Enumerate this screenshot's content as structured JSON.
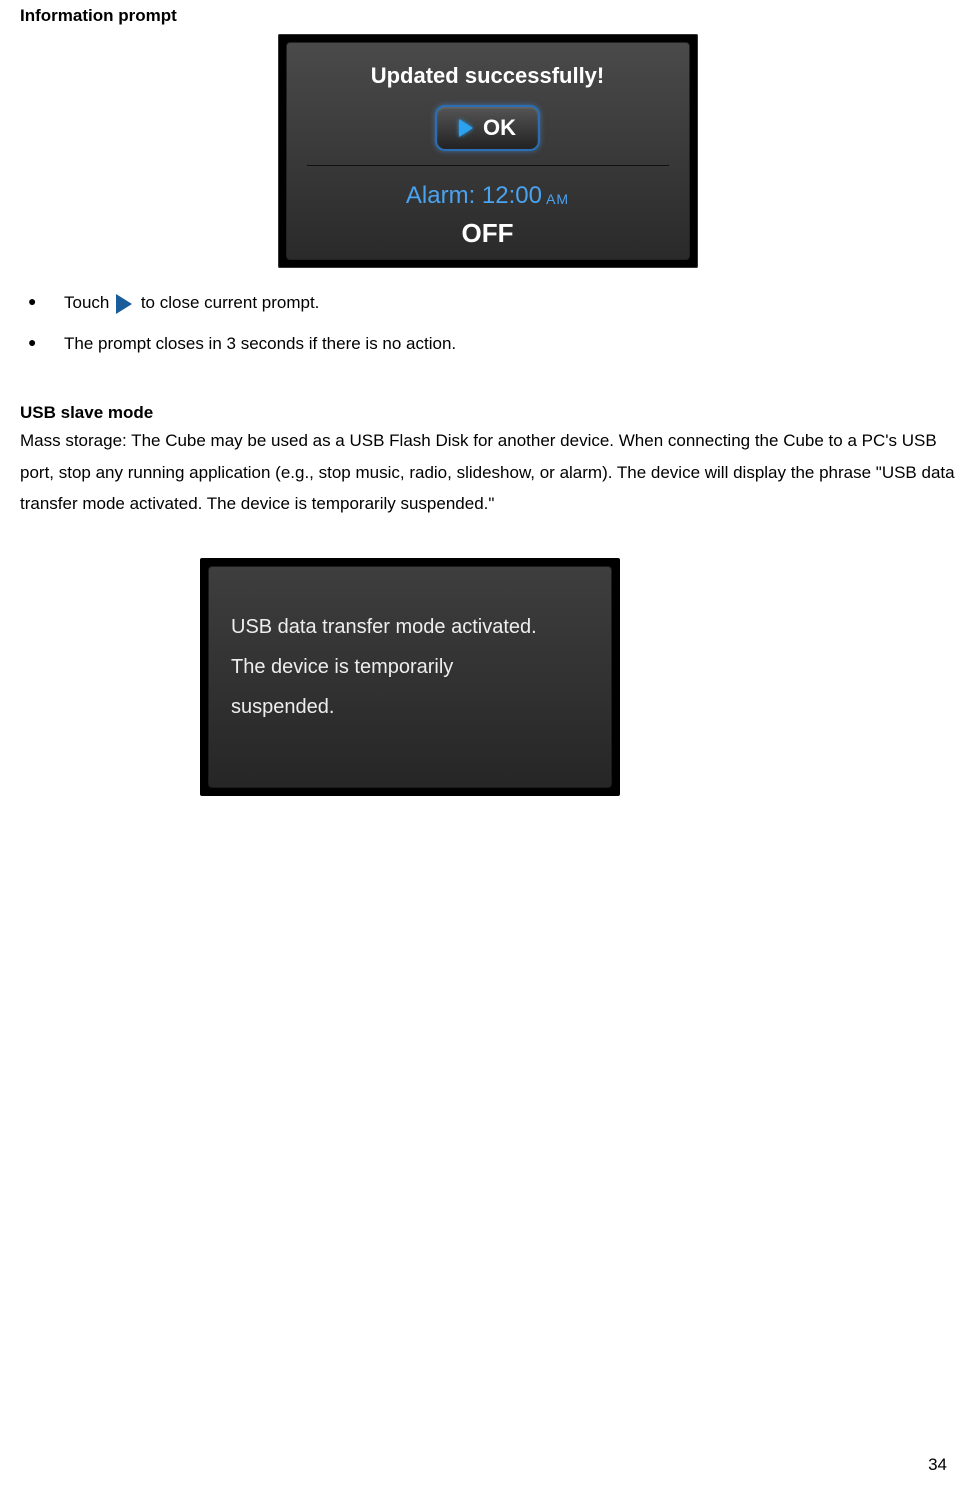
{
  "section1": {
    "title": "Information prompt"
  },
  "prompt": {
    "updated": "Updated  successfully!",
    "ok": "OK",
    "alarm_label": "Alarm: ",
    "alarm_time": "12:00",
    "alarm_ampm": " AM",
    "off": "OFF"
  },
  "bullets": {
    "touch_prefix": "Touch ",
    "touch_suffix": "to close current prompt.",
    "auto_close": "The prompt closes in 3 seconds if there is no action."
  },
  "section2": {
    "title": "USB slave mode",
    "para": "Mass storage: The Cube may be used as a USB Flash Disk for another device.\nWhen connecting the Cube to a PC's USB port, stop any running application (e.g., stop music, radio, slideshow, or alarm). The device will display the phrase \"USB data transfer mode activated. The device is temporarily suspended.\""
  },
  "usb": {
    "line1": "USB data transfer mode activated.",
    "line2": "The device is temporarily",
    "line3": "suspended."
  },
  "page_number": "34"
}
